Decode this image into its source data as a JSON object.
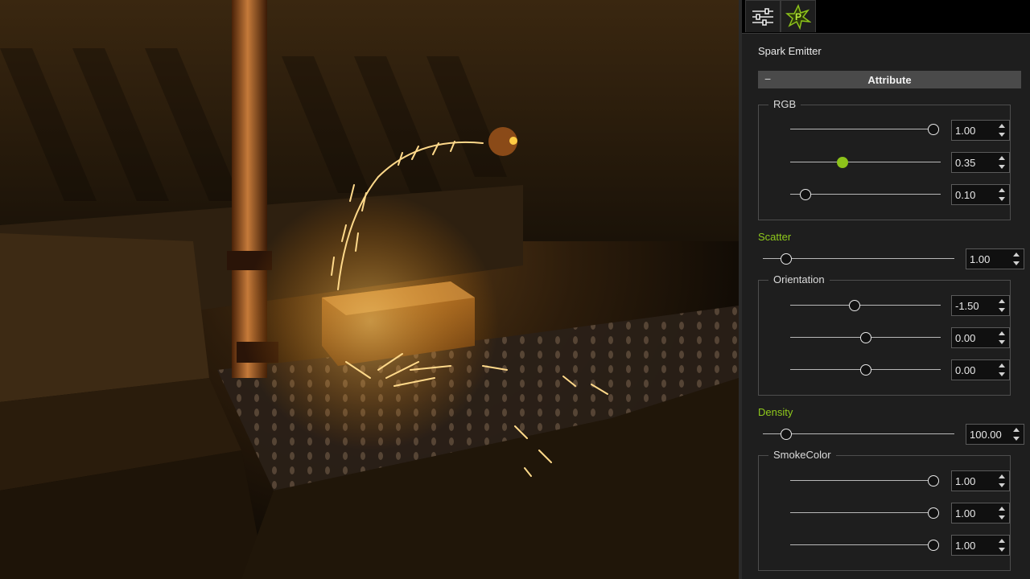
{
  "panel": {
    "title": "Spark Emitter",
    "attribute_header": "Attribute",
    "attribute_toggle": "−",
    "tabs": [
      {
        "name": "tab-settings",
        "icon": "sliders-icon",
        "active": false
      },
      {
        "name": "tab-spark-emitter",
        "icon": "spark-emitter-icon",
        "active": true
      }
    ]
  },
  "rgb": {
    "label": "RGB",
    "r": {
      "value": "1.00",
      "fraction": 1.0
    },
    "g": {
      "value": "0.35",
      "fraction": 0.35
    },
    "b": {
      "value": "0.10",
      "fraction": 0.1
    }
  },
  "scatter": {
    "label": "Scatter",
    "value": "1.00",
    "fraction": 0.12
  },
  "orientation": {
    "label": "Orientation",
    "x": {
      "value": "-1.50",
      "fraction": 0.43
    },
    "y": {
      "value": "0.00",
      "fraction": 0.5
    },
    "z": {
      "value": "0.00",
      "fraction": 0.5
    }
  },
  "density": {
    "label": "Density",
    "value": "100.00",
    "fraction": 0.12
  },
  "smoke_color": {
    "label": "SmokeColor",
    "r": {
      "value": "1.00",
      "fraction": 1.0
    },
    "g": {
      "value": "1.00",
      "fraction": 1.0
    },
    "b": {
      "value": "1.00",
      "fraction": 1.0
    }
  },
  "colors": {
    "accent": "#8cc21a",
    "panel_bg": "#1e1e1e",
    "header_bg": "#4a4a4a"
  }
}
